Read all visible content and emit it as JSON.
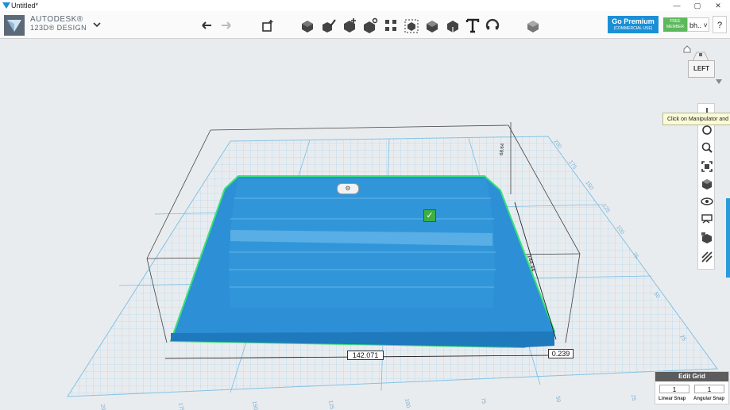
{
  "window": {
    "title": "Untitled*",
    "minimize_icon": "minimize-icon",
    "maximize_icon": "maximize-icon",
    "close_icon": "close-icon"
  },
  "app": {
    "brand_line1": "AUTODESK®",
    "brand_line2": "123D® DESIGN"
  },
  "toolbar": {
    "undo": "undo-icon",
    "redo": "redo-icon",
    "tools": [
      "transform-icon",
      "primitives-icon",
      "sketch-icon",
      "construct-icon",
      "modify-icon",
      "pattern-icon",
      "grouping-icon",
      "combine-icon",
      "measure-icon",
      "text-icon",
      "snap-icon",
      "material-icon"
    ]
  },
  "account": {
    "premium_title": "Go Premium",
    "premium_sub": "(COMMERCIAL USE)",
    "free_badge_1": "FREE",
    "free_badge_2": "MEMBER",
    "user": "bh..",
    "help": "?"
  },
  "viewcube": {
    "face": "LEFT"
  },
  "tooltip": {
    "text": "Click on Manipulator and d"
  },
  "dimensions": {
    "length": "142.071",
    "height": "0.239",
    "width": "144.44",
    "depth": "68.64"
  },
  "ruler": {
    "bottom": [
      "200",
      "175",
      "150",
      "125",
      "100",
      "75",
      "50",
      "25"
    ],
    "right": [
      "200",
      "175",
      "150",
      "125",
      "100",
      "75",
      "50",
      "25"
    ]
  },
  "edit_grid": {
    "title": "Edit Grid",
    "linear_snap_value": "1",
    "angular_snap_value": "1",
    "linear_snap_label": "Linear Snap",
    "angular_snap_label": "Angular Snap"
  },
  "colors": {
    "accent": "#1b8fd6",
    "model": "#2b8fd4",
    "selection": "#39e07a",
    "grid": "#a8d6ee",
    "background": "#e9ecef"
  }
}
